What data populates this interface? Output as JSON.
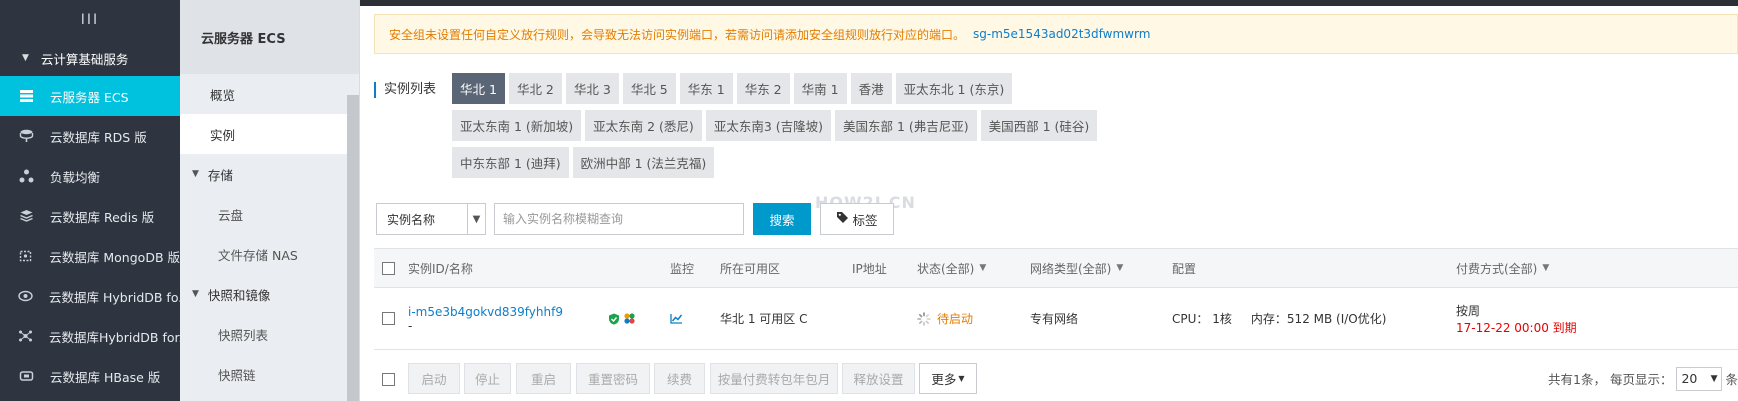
{
  "sidebar": {
    "top_icon": "III",
    "group_label": "云计算基础服务",
    "items": [
      {
        "label": "云服务器 ECS",
        "icon": "server-icon",
        "active": true
      },
      {
        "label": "云数据库 RDS 版",
        "icon": "database-icon",
        "active": false
      },
      {
        "label": "负载均衡",
        "icon": "load-balancer-icon",
        "active": false
      },
      {
        "label": "云数据库 Redis 版",
        "icon": "redis-icon",
        "active": false
      },
      {
        "label": "云数据库 MongoDB 版",
        "icon": "mongodb-icon",
        "active": false
      },
      {
        "label": "云数据库 HybridDB fo...",
        "icon": "hybriddb-icon",
        "active": false
      },
      {
        "label": "云数据库HybridDB for...",
        "icon": "hybriddb2-icon",
        "active": false
      },
      {
        "label": "云数据库 HBase 版",
        "icon": "hbase-icon",
        "active": false
      }
    ]
  },
  "subnav": {
    "title": "云服务器 ECS",
    "overview": "概览",
    "instances": "实例",
    "storage_group": "存储",
    "disk": "云盘",
    "nas": "文件存储 NAS",
    "snapshot_group": "快照和镜像",
    "snapshot_list": "快照列表",
    "snapshot_chain": "快照链"
  },
  "alert": {
    "text": "安全组未设置任何自定义放行规则，会导致无法访问实例端口，若需访问请添加安全组规则放行对应的端口。",
    "sg_link": "sg-m5e1543ad02t3dfwmwrm"
  },
  "regions": {
    "label": "实例列表",
    "items": [
      {
        "label": "华北 1",
        "active": true
      },
      {
        "label": "华北 2"
      },
      {
        "label": "华北 3"
      },
      {
        "label": "华北 5"
      },
      {
        "label": "华东 1"
      },
      {
        "label": "华东 2"
      },
      {
        "label": "华南 1"
      },
      {
        "label": "香港"
      },
      {
        "label": "亚太东北 1 (东京)"
      },
      {
        "label": "亚太东南 1 (新加坡)"
      },
      {
        "label": "亚太东南 2 (悉尼)"
      },
      {
        "label": "亚太东南3 (吉隆坡)"
      },
      {
        "label": "美国东部 1 (弗吉尼亚)"
      },
      {
        "label": "美国西部 1 (硅谷)"
      },
      {
        "label": "中东东部 1 (迪拜)"
      },
      {
        "label": "欧洲中部 1 (法兰克福)"
      }
    ]
  },
  "watermark": "HOW2J.CN",
  "filter": {
    "select_value": "实例名称",
    "search_placeholder": "输入实例名称模糊查询",
    "search_button": "搜索",
    "tag_button": "标签"
  },
  "table": {
    "headers": {
      "id_name": "实例ID/名称",
      "monitor": "监控",
      "zone": "所在可用区",
      "ip": "IP地址",
      "status": "状态(全部)",
      "network": "网络类型(全部)",
      "config": "配置",
      "billing": "付费方式(全部)"
    },
    "rows": [
      {
        "id": "i-m5e3b4gokvd839fyhhf9",
        "name": "-",
        "zone": "华北 1 可用区 C",
        "ip": "",
        "status": "待启动",
        "network": "专有网络",
        "config": "CPU： 1核     内存：512 MB (I/O优化)",
        "billing_type": "按周",
        "expiry": "17-12-22 00:00 到期"
      }
    ]
  },
  "footer": {
    "buttons": [
      "启动",
      "停止",
      "重启",
      "重置密码",
      "续费",
      "按量付费转包年包月",
      "释放设置"
    ],
    "more": "更多",
    "total_text": "共有1条， 每页显示：",
    "page_size": "20",
    "unit": "条"
  },
  "colors": {
    "sidebar_bg": "#2f3540",
    "active_item": "#00c1de",
    "region_active": "#5a6675",
    "search_button": "#0099cc",
    "link": "#0d7ec9",
    "warning": "#e37d00",
    "due": "#e80000"
  }
}
